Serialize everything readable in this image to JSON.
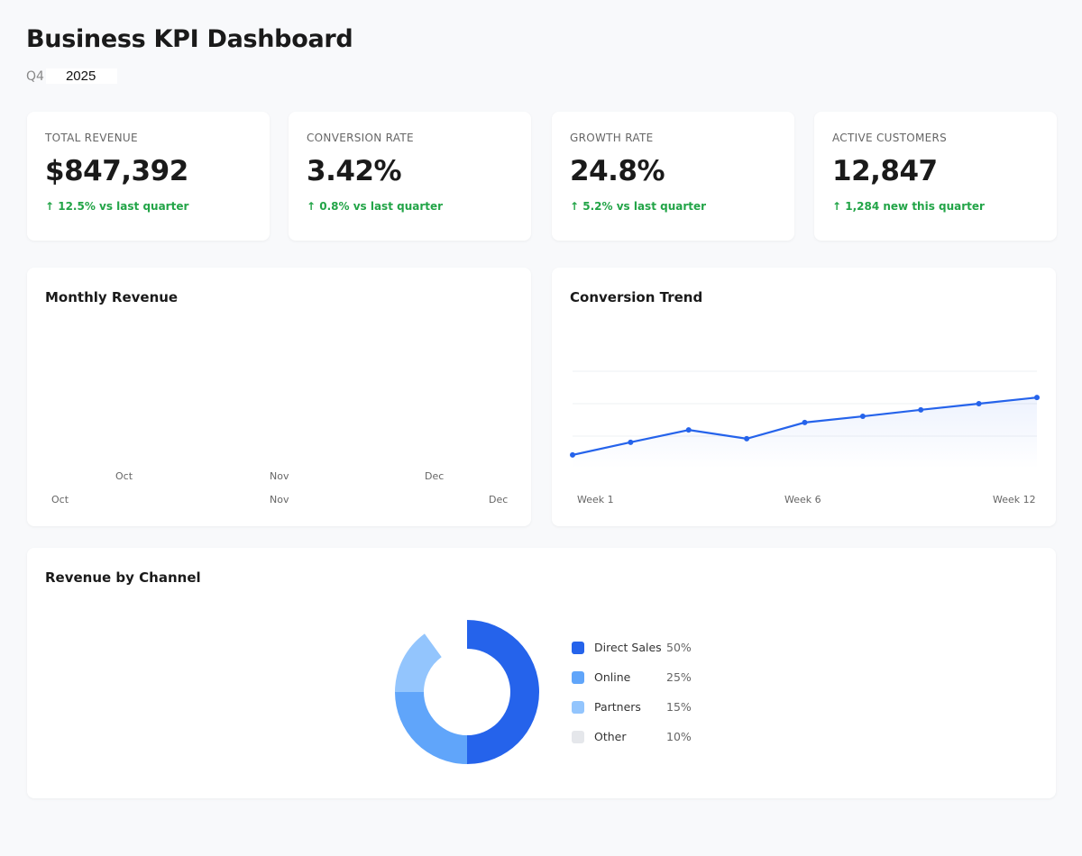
{
  "header": {
    "title": "Business KPI Dashboard",
    "quarter": "Q4",
    "year": "2025"
  },
  "kpis": [
    {
      "label": "TOTAL REVENUE",
      "value": "$847,392",
      "change": "↑ 12.5% vs last quarter"
    },
    {
      "label": "CONVERSION RATE",
      "value": "3.42%",
      "change": "↑ 0.8% vs last quarter"
    },
    {
      "label": "GROWTH RATE",
      "value": "24.8%",
      "change": "↑ 5.2% vs last quarter"
    },
    {
      "label": "ACTIVE CUSTOMERS",
      "value": "12,847",
      "change": "↑ 1,284 new this quarter"
    }
  ],
  "colors": {
    "positive": "#22a447",
    "line": "#2563eb"
  },
  "chart_data": [
    {
      "type": "bar",
      "title": "Monthly Revenue",
      "categories": [
        "Oct",
        "Nov",
        "Dec"
      ],
      "values": [],
      "axis_labels_row1": [
        "Oct",
        "Nov",
        "Dec"
      ],
      "axis_labels_row2": [
        "Oct",
        "Nov",
        "Dec"
      ]
    },
    {
      "type": "line",
      "title": "Conversion Trend",
      "x_tick_labels": [
        "Week 1",
        "Week 6",
        "Week 12"
      ],
      "values": [
        0.42,
        0.81,
        1.19,
        0.92,
        1.42,
        1.61,
        1.81,
        2.0,
        2.19
      ],
      "ylim": [
        0,
        4
      ],
      "grid": true,
      "area_fill": true,
      "color": "#2563eb"
    },
    {
      "type": "pie",
      "title": "Revenue by Channel",
      "donut": true,
      "legend_position": "right",
      "slices": [
        {
          "label": "Direct Sales",
          "value": 50,
          "pct": "50%",
          "color": "#2563eb"
        },
        {
          "label": "Online",
          "value": 25,
          "pct": "25%",
          "color": "#60a5fa"
        },
        {
          "label": "Partners",
          "value": 15,
          "pct": "15%",
          "color": "#93c5fd"
        },
        {
          "label": "Other",
          "value": 10,
          "pct": "10%",
          "color": "#e5e7eb"
        }
      ]
    }
  ]
}
